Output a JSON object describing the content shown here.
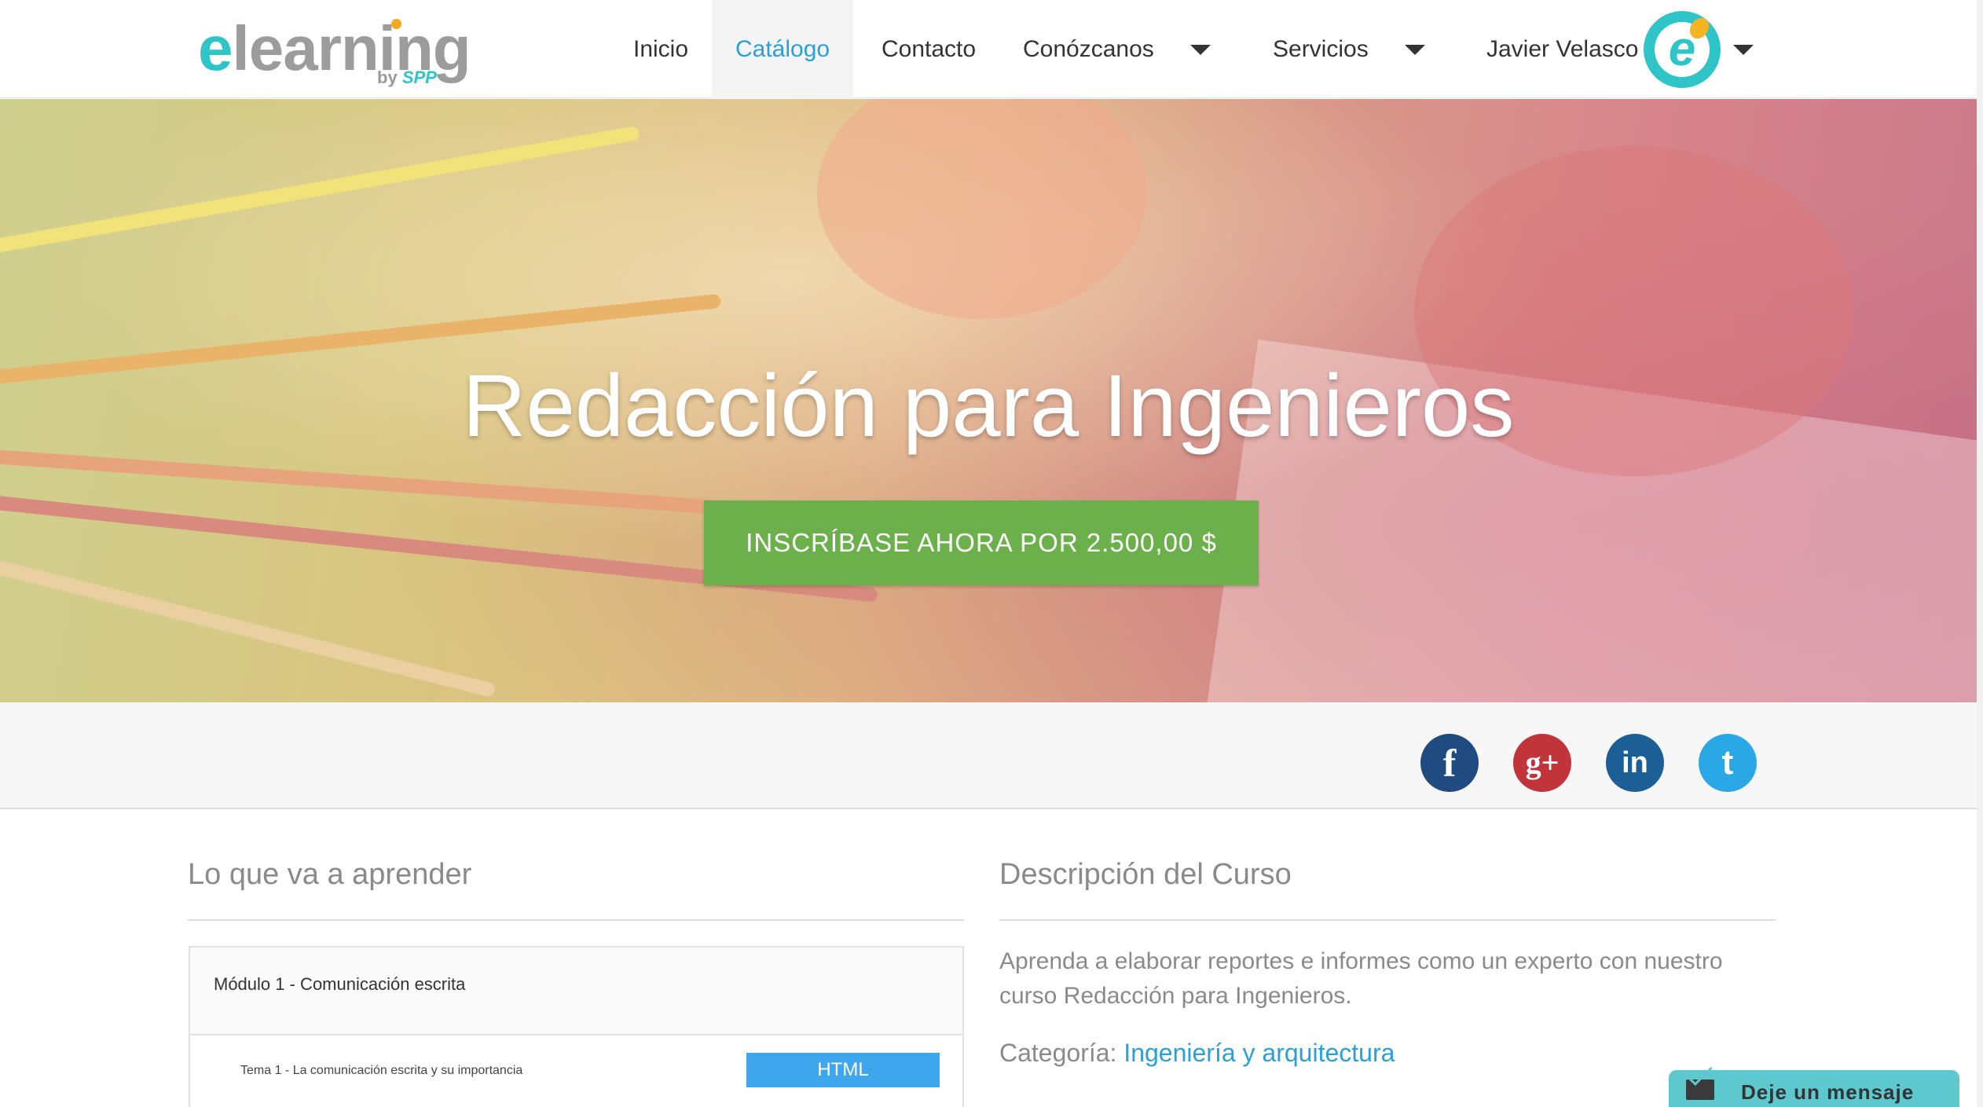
{
  "header": {
    "logo": {
      "word_e": "e",
      "word_rest": "learning",
      "by": "by",
      "brand": "SPP"
    },
    "nav": [
      {
        "label": "Inicio",
        "active": false
      },
      {
        "label": "Catálogo",
        "active": true
      },
      {
        "label": "Contacto",
        "active": false
      },
      {
        "label": "Conózcanos",
        "active": false,
        "dropdown": true
      },
      {
        "label": "Servicios",
        "active": false,
        "dropdown": true
      }
    ],
    "user": {
      "name": "Javier Velasco",
      "avatar_letter": "e"
    }
  },
  "hero": {
    "title": "Redacción para Ingenieros",
    "enroll_label": "INSCRÍBASE AHORA POR 2.500,00 $"
  },
  "social": [
    {
      "network": "facebook",
      "glyph": "f",
      "color": "#1f4b80"
    },
    {
      "network": "google-plus",
      "glyph": "g+",
      "color": "#c0343a"
    },
    {
      "network": "linkedin",
      "glyph": "in",
      "color": "#1c5f96"
    },
    {
      "network": "twitter",
      "glyph": "t",
      "color": "#2aa8e6"
    }
  ],
  "learn": {
    "heading": "Lo que va a aprender",
    "modules": [
      {
        "title": "Módulo 1 - Comunicación escrita",
        "topics": [
          {
            "title": "Tema 1 - La comunicación escrita y su importancia",
            "type": "HTML"
          }
        ]
      }
    ]
  },
  "description": {
    "heading": "Descripción del Curso",
    "text": "Aprenda a elaborar reportes e informes como un experto con nuestro curso Redacción para Ingenieros.",
    "category_label": "Categoría:",
    "category_value": "Ingeniería y arquitectura"
  },
  "chat": {
    "label": "Deje un mensaje",
    "icon": "envelope-icon"
  },
  "colors": {
    "accent": "#2a9fd8",
    "enroll": "#6bb04a",
    "brand": "#2ec4c8",
    "html_button": "#3ea6ec"
  }
}
